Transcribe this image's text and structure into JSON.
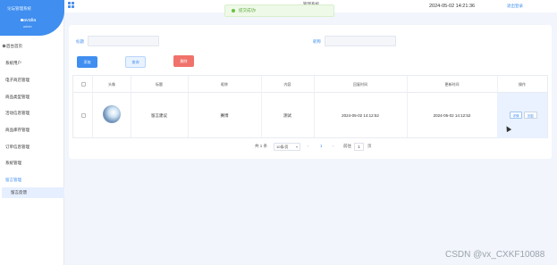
{
  "sidebar": {
    "system_name": "论坛管理系统",
    "username": "avalia",
    "role": "admin",
    "items": [
      {
        "label": "后台首页"
      },
      {
        "label": "系统用户"
      },
      {
        "label": "电子商店管理"
      },
      {
        "label": "商品类型管理"
      },
      {
        "label": "活动信息管理"
      },
      {
        "label": "商品库存管理"
      },
      {
        "label": "订单信息管理"
      },
      {
        "label": "系统管理"
      },
      {
        "label": "留言管理"
      },
      {
        "label": "留言反馈"
      }
    ]
  },
  "topbar": {
    "title": "管理系统",
    "datetime": "2024-05-02 14:21:36",
    "link": "退出登录"
  },
  "toast": {
    "message": "提交成功!"
  },
  "search": {
    "field1_label": "标题",
    "field2_label": "昵称",
    "add_label": "添加",
    "query_label": "查询",
    "delete_label": "删除"
  },
  "table": {
    "headers": [
      "",
      "头像",
      "标题",
      "昵称",
      "内容",
      "回复时间",
      "更新时间",
      "操作"
    ],
    "rows": [
      {
        "title": "留言建议",
        "nickname": "赛博",
        "content": "测试",
        "reply_time": "2024-05-02 14:12:52",
        "update_time": "2024-05-02 14:12:52",
        "detail_label": "详情",
        "edit_label": "回复"
      }
    ]
  },
  "pagination": {
    "total": "共 1 条",
    "page_size": "10条/页",
    "prev": "‹",
    "current": "1",
    "next": "›",
    "goto_label": "前往",
    "goto_value": "1",
    "page_unit": "页"
  },
  "watermark": "CSDN @vx_CXKF10088"
}
